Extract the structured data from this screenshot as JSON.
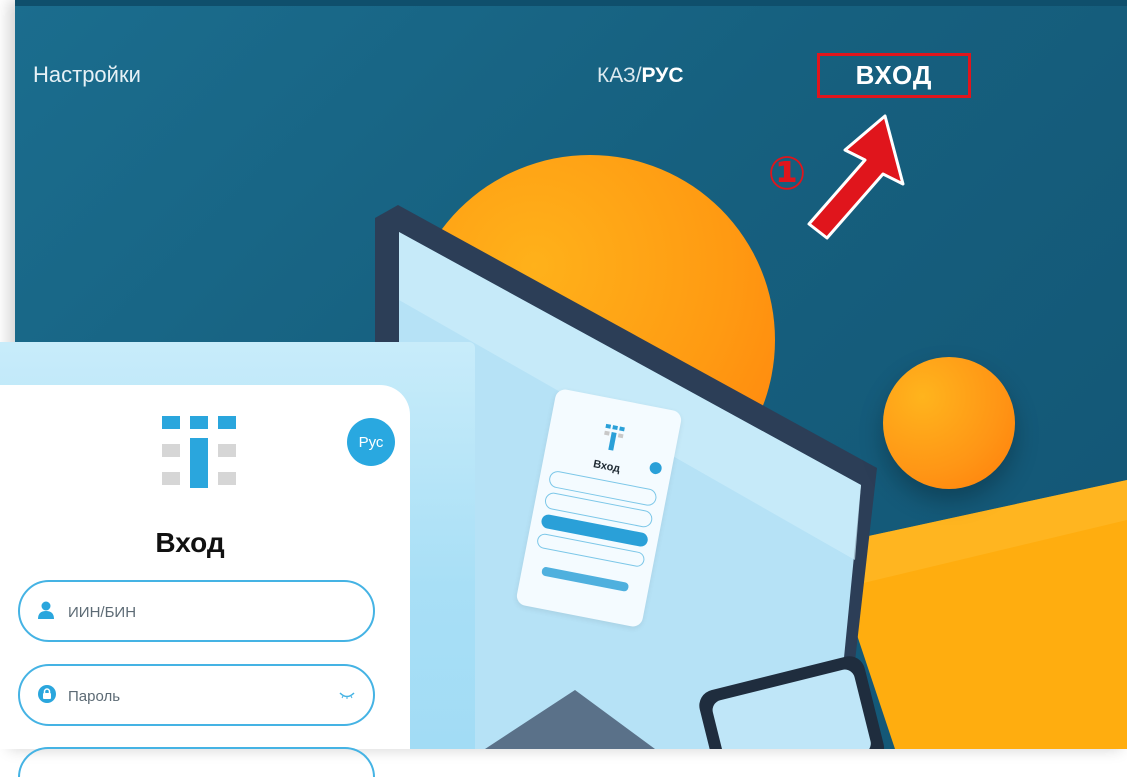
{
  "nav": {
    "settings_label": "Настройки",
    "lang_kz": "КАЗ",
    "lang_separator": "/",
    "lang_ru": "РУС",
    "login_label": "ВХОД"
  },
  "annotation": {
    "step": "①",
    "highlight_color": "#e0151c"
  },
  "mini_form": {
    "title": "Вход"
  },
  "login_form": {
    "lang_button": "Рус",
    "title": "Вход",
    "iin_placeholder": "ИИН/БИН",
    "password_placeholder": "Пароль",
    "icons": [
      "logo-icon",
      "user-icon",
      "lock-icon",
      "eye-icon"
    ]
  },
  "colors": {
    "hero_bg": "#16607f",
    "accent_blue": "#29a8e0",
    "orange": "#ff9a12",
    "yellow": "#ffad0f"
  }
}
